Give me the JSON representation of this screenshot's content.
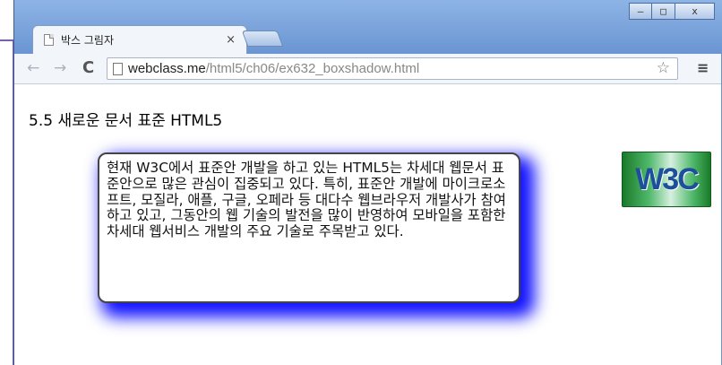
{
  "window": {
    "controls": {
      "minimize": "–",
      "maximize": "□",
      "close": "x"
    }
  },
  "tab": {
    "title": "박스 그림자",
    "close": "×"
  },
  "toolbar": {
    "back": "←",
    "forward": "→",
    "reload": "C",
    "url_host": "webclass.me",
    "url_path": "/html5/ch06/ex632_boxshadow.html",
    "star": "☆",
    "menu": "≡"
  },
  "page": {
    "heading": "5.5 새로운 문서 표준 HTML5",
    "box_text": "현재 W3C에서 표준안 개발을 하고 있는 HTML5는 차세대 웹문서 표준안으로 많은 관심이 집중되고 있다. 특히, 표준안 개발에 마이크로소프트, 모질라, 애플, 구글, 오페라 등 대다수 웹브라우저 개발사가 참여하고 있고, 그동안의 웹 기술의 발전을 많이 반영하여 모바일을 포함한 차세대 웹서비스 개발의 주요 기술로 주목받고 있다.",
    "logo_text": "W3C"
  },
  "colors": {
    "shadow": "#1212ff",
    "frame": "#6a95d2",
    "logo_green": "#1a7a2a"
  },
  "icons": [
    "page-icon",
    "back-icon",
    "forward-icon",
    "reload-icon",
    "star-icon",
    "menu-icon",
    "w3c-logo"
  ]
}
